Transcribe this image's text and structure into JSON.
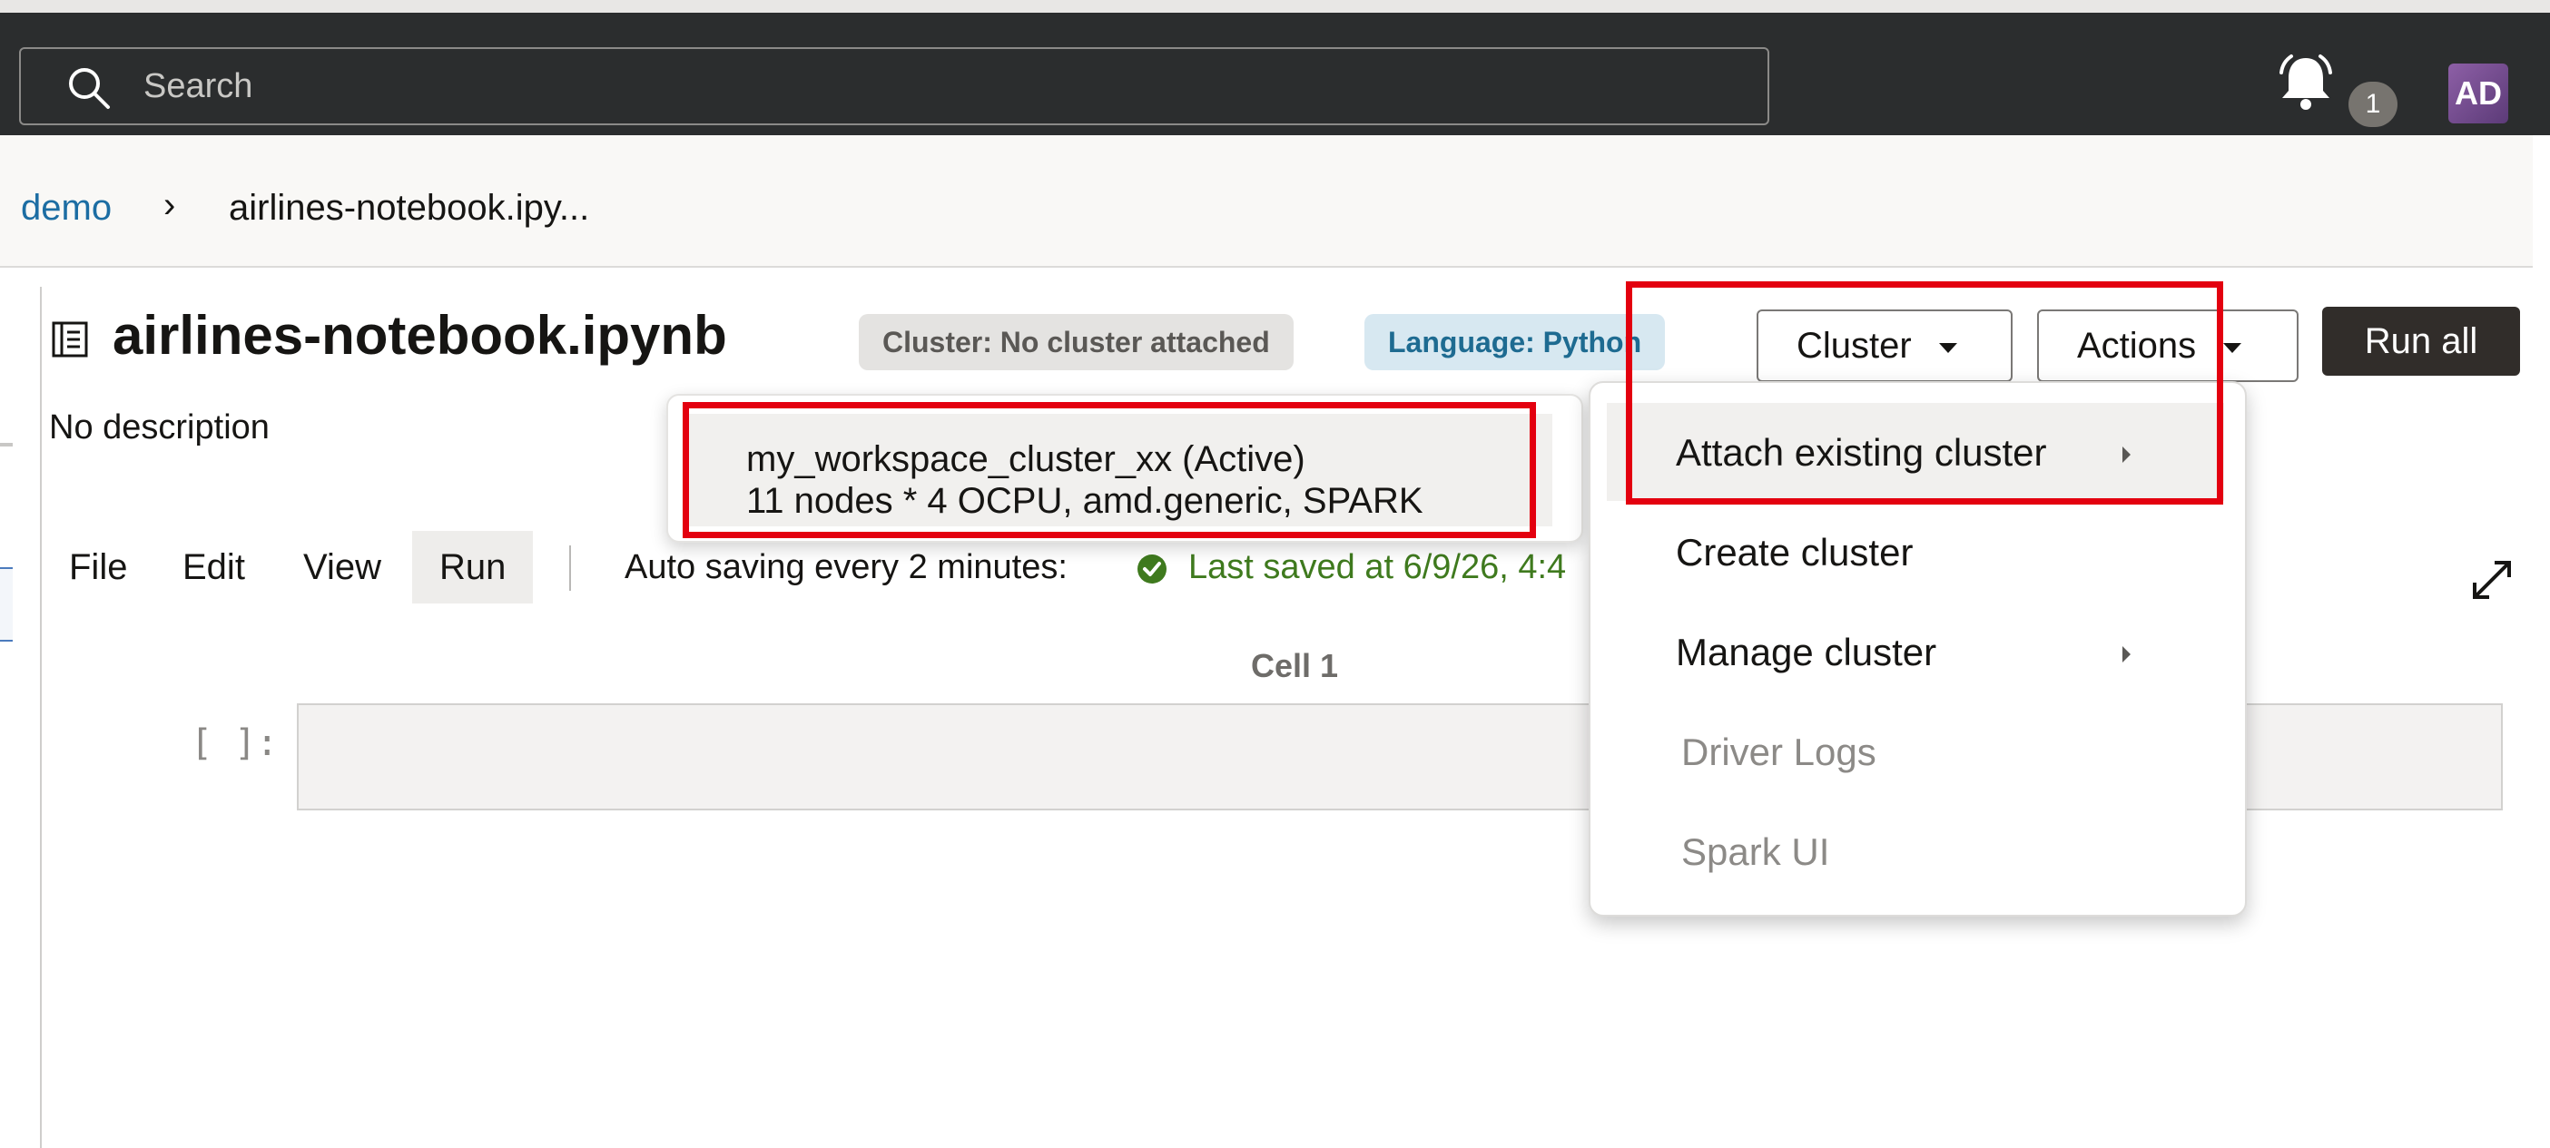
{
  "header": {
    "search_placeholder": "Search",
    "notifications_count": "1",
    "avatar_initials": "AD",
    "icons": [
      "search-icon",
      "bell-icon"
    ]
  },
  "breadcrumb": {
    "items": [
      "demo",
      "airlines-notebook.ipy..."
    ],
    "separator": "›"
  },
  "notebook": {
    "title": "airlines-notebook.ipynb",
    "description": "No description",
    "cluster_badge": "Cluster: No cluster attached",
    "language_badge": "Language: Python"
  },
  "toolbar": {
    "cluster_label": "Cluster",
    "actions_label": "Actions",
    "run_all_label": "Run all"
  },
  "menu_bar": {
    "items": [
      "File",
      "Edit",
      "View",
      "Run"
    ],
    "autosave_text": "Auto saving every 2 minutes:",
    "last_saved_text": "Last saved at 6/9/26, 4:4"
  },
  "cell": {
    "label": "Cell 1",
    "prompt": "[ ]:"
  },
  "cluster_menu": {
    "items": [
      {
        "label": "Attach existing cluster",
        "has_submenu": true,
        "enabled": true
      },
      {
        "label": "Create cluster",
        "has_submenu": false,
        "enabled": true
      },
      {
        "label": "Manage cluster",
        "has_submenu": true,
        "enabled": true
      },
      {
        "label": "Driver Logs",
        "has_submenu": false,
        "enabled": false
      },
      {
        "label": "Spark UI",
        "has_submenu": false,
        "enabled": false
      }
    ]
  },
  "cluster_flyout": {
    "option_name": "my_workspace_cluster_xx (Active)",
    "option_detail": "11 nodes * 4 OCPU, amd.generic, SPARK"
  },
  "colors": {
    "header_bg": "#2b2d2e",
    "link": "#1c6da3",
    "saved_green": "#3f7a1e",
    "highlight_red": "#e3000f",
    "run_all_bg": "#312d2a"
  }
}
